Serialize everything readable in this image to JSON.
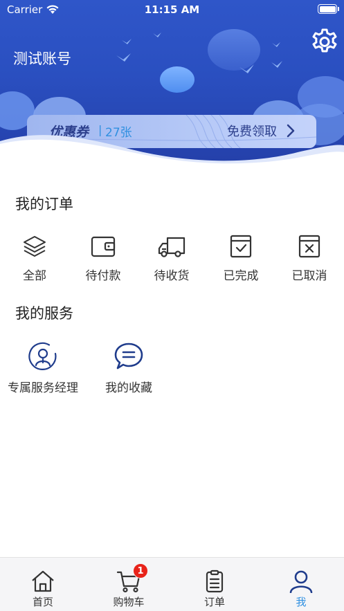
{
  "status_bar": {
    "carrier": "Carrier",
    "time": "11:15 AM"
  },
  "header": {
    "account_name": "测试账号",
    "settings_icon": "gear-icon",
    "coupon": {
      "title": "优惠券",
      "separator": "|",
      "count": "27张",
      "claim_label": "免费领取"
    }
  },
  "orders": {
    "title": "我的订单",
    "items": [
      {
        "label": "全部",
        "icon": "layers-icon"
      },
      {
        "label": "待付款",
        "icon": "wallet-icon"
      },
      {
        "label": "待收货",
        "icon": "truck-icon"
      },
      {
        "label": "已完成",
        "icon": "check-box-icon"
      },
      {
        "label": "已取消",
        "icon": "cancel-box-icon"
      }
    ]
  },
  "services": {
    "title": "我的服务",
    "items": [
      {
        "label": "专属服务经理",
        "icon": "manager-icon"
      },
      {
        "label": "我的收藏",
        "icon": "chat-bubble-icon"
      }
    ]
  },
  "tabbar": {
    "items": [
      {
        "label": "首页",
        "icon": "home-icon"
      },
      {
        "label": "购物车",
        "icon": "cart-icon",
        "badge": "1"
      },
      {
        "label": "订单",
        "icon": "clipboard-icon"
      },
      {
        "label": "我",
        "icon": "user-icon",
        "active": true
      }
    ]
  },
  "colors": {
    "header_blue": "#2a4fc0",
    "accent_blue": "#2f8fe0",
    "icon_navy": "#1f3c8c",
    "badge_red": "#e8231a"
  }
}
